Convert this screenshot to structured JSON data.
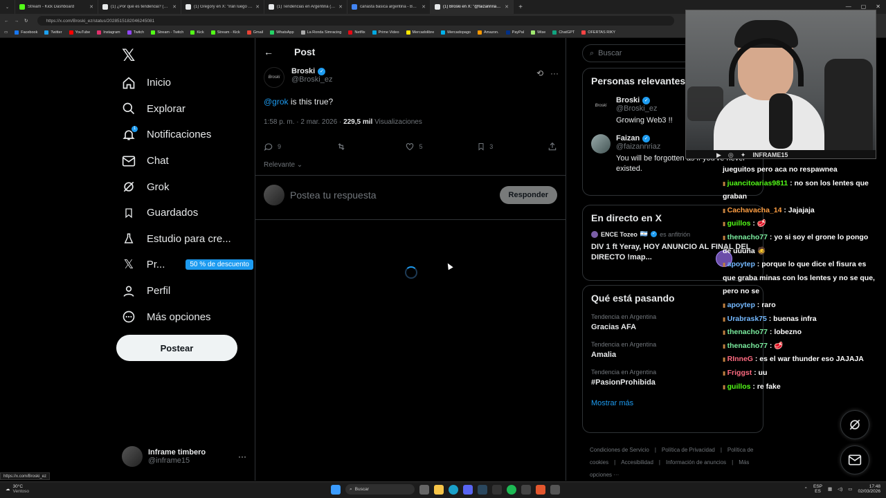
{
  "browser": {
    "tabs": [
      {
        "title": "Stream - Kick Dashboard",
        "color": "#53fc18"
      },
      {
        "title": "(1) ¿Por qué es tendencia? (@porq",
        "color": "#e7e9ea"
      },
      {
        "title": "(1) Gregory en X: \"Irán luego de",
        "color": "#e7e9ea"
      },
      {
        "title": "(1) Tendencias en Argentina (@porq",
        "color": "#e7e9ea"
      },
      {
        "title": "canasta basica argentina - Buscar",
        "color": "#4285f4"
      },
      {
        "title": "(1) Broski en X: \"@faizannriaz @gr",
        "color": "#e7e9ea",
        "active": true
      }
    ],
    "url": "https://x.com/Broski_ez/status/2028515182046245081",
    "bookmarks": [
      "Facebook",
      "Twitter",
      "YouTube",
      "Instagram",
      "Twitch",
      "Stream - Twitch",
      "Kick",
      "Stream - Kick",
      "Gmail",
      "WhatsApp",
      "La Ronda Simracing",
      "Netflix",
      "Prime Video",
      "Mercadolibre",
      "Mercadopago",
      "Amazon.",
      "PayPal",
      "Wise",
      "ChatGPT",
      "OFERTAS RIKY"
    ],
    "status_url": "https://x.com/Broski_ez"
  },
  "nav": {
    "items": [
      {
        "label": "Inicio",
        "icon": "home-icon"
      },
      {
        "label": "Explorar",
        "icon": "search-icon"
      },
      {
        "label": "Notificaciones",
        "icon": "bell-icon",
        "badge": "1"
      },
      {
        "label": "Chat",
        "icon": "mail-icon"
      },
      {
        "label": "Grok",
        "icon": "grok-icon"
      },
      {
        "label": "Guardados",
        "icon": "bookmark-icon"
      },
      {
        "label": "Estudio para cre...",
        "icon": "flask-icon"
      },
      {
        "label": "Pr...",
        "icon": "x-icon",
        "promo": "50 % de descuento"
      },
      {
        "label": "Perfil",
        "icon": "person-icon"
      },
      {
        "label": "Más opciones",
        "icon": "more-circle-icon"
      }
    ],
    "post_button": "Postear",
    "account": {
      "name": "Inframe timbero",
      "handle": "@inframe15",
      "more": "···"
    }
  },
  "post": {
    "header": "Post",
    "author_name": "Broski",
    "author_handle": "@Broski_ez",
    "avatar_text": "Broski",
    "mention": "@grok",
    "text": " is this true?",
    "time": "1:58 p. m. · 2 mar. 2026 · ",
    "views": "229,5 mil",
    "views_label": " Visualizaciones",
    "replies": "9",
    "reposts": "",
    "likes": "5",
    "bookmarks": "3",
    "sort": "Relevante",
    "reply_placeholder": "Postea tu respuesta",
    "reply_button": "Responder"
  },
  "right": {
    "search_placeholder": "Buscar",
    "relevant_title": "Personas relevantes",
    "people": [
      {
        "name": "Broski",
        "handle": "@Broski_ez",
        "bio": "Growing Web3 !!",
        "avatar_text": "Broski"
      },
      {
        "name": "Faizan",
        "handle": "@faizannriaz",
        "bio": "You will be forgotten as if you've never existed."
      }
    ],
    "live_title": "En directo en X",
    "live_host": "ENCE Tozeo",
    "live_flag": "🇦🇷",
    "live_role": "es anfitrión",
    "live_desc": "DIV 1 ft Yeray, HOY ANUNCIO AL FINAL DEL DIRECTO !map...",
    "trends_title": "Qué está pasando",
    "trends": [
      {
        "category": "Tendencia en Argentina",
        "name": "Gracias AFA"
      },
      {
        "category": "Tendencia en Argentina",
        "name": "Amalia"
      },
      {
        "category": "Tendencia en Argentina",
        "name": "#PasionProhibida"
      }
    ],
    "show_more": "Mostrar más",
    "footer": [
      "Condiciones de Servicio",
      "|",
      "Política de Privacidad",
      "|",
      "Política de cookies",
      "|",
      "Accesibilidad",
      "|",
      "Información de anuncios",
      "|",
      "Más opciones ···"
    ]
  },
  "stream": {
    "bar_icons": [
      "youtube-icon",
      "instagram-icon",
      "twitter-icon"
    ],
    "bar_label": "INFRAME15",
    "chat": [
      {
        "user": "",
        "text": "jueguitos pero aca no respawnea",
        "color": "#ffffff"
      },
      {
        "user": "juancitoarias9811",
        "text": " : no son los lentes que graban",
        "color": "#53fc18"
      },
      {
        "user": "Cachavacha_14",
        "text": " : Jajajaja",
        "color": "#ff9f43"
      },
      {
        "user": "guillos",
        "text": " : 🥩",
        "color": "#53fc18"
      },
      {
        "user": "thenacho77",
        "text": " : yo si soy el grone lo pongo de uuuna 🧔",
        "color": "#7bed9f"
      },
      {
        "user": "apoytep",
        "text": " : porque lo que dice el fisura es que graba minas con los lentes y no se que, pero no se",
        "color": "#74b9ff"
      },
      {
        "user": "apoytep",
        "text": " : raro",
        "color": "#74b9ff"
      },
      {
        "user": "Urabrask75",
        "text": " : buenas infra",
        "color": "#74b9ff"
      },
      {
        "user": "thenacho77",
        "text": " : lobezno",
        "color": "#7bed9f"
      },
      {
        "user": "thenacho77",
        "text": " : 🥩",
        "color": "#7bed9f"
      },
      {
        "user": "RInneG",
        "text": " : es el war thunder eso JAJAJA",
        "color": "#ff6b81"
      },
      {
        "user": "Friggst",
        "text": " : uu",
        "color": "#ff6b81"
      },
      {
        "user": "guillos",
        "text": " : re fake",
        "color": "#53fc18"
      }
    ]
  },
  "taskbar": {
    "temp": "30°C",
    "weather": "Ventoso",
    "search": "Buscar",
    "lang": "ESP",
    "lang2": "ES",
    "time": "17:48",
    "date": "02/03/2026"
  }
}
